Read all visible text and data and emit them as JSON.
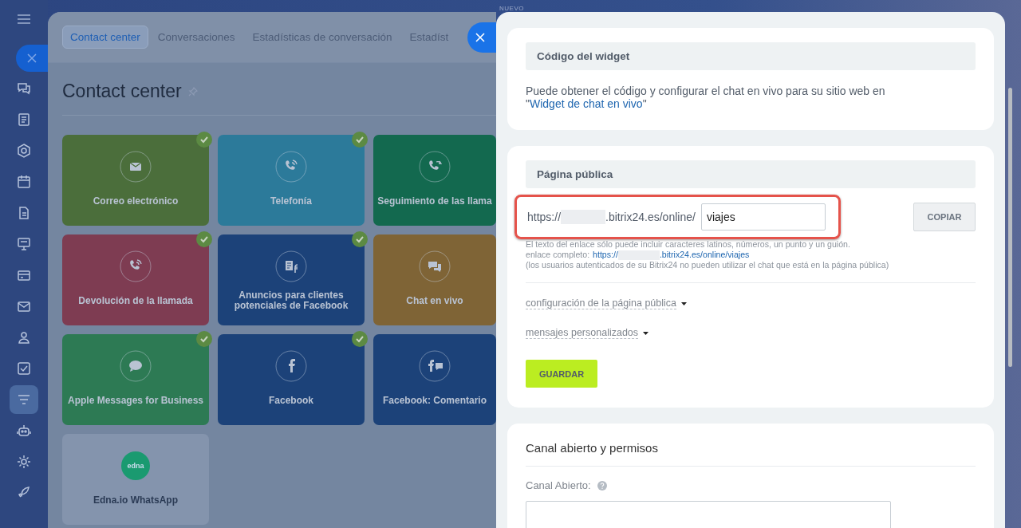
{
  "wallpaper_label": "NUEVO",
  "sidebar": {
    "items": [
      {
        "kind": "close",
        "selected": false
      },
      {
        "kind": "chat",
        "selected": false
      },
      {
        "kind": "document",
        "selected": false
      },
      {
        "kind": "hexagon",
        "selected": false
      },
      {
        "kind": "calendar",
        "selected": false
      },
      {
        "kind": "page",
        "selected": false
      },
      {
        "kind": "board",
        "selected": false
      },
      {
        "kind": "card",
        "selected": false
      },
      {
        "kind": "mail",
        "selected": false
      },
      {
        "kind": "people",
        "selected": false
      },
      {
        "kind": "checkbox",
        "selected": false
      },
      {
        "kind": "filter",
        "selected": true
      },
      {
        "kind": "robot",
        "selected": false
      },
      {
        "kind": "settings",
        "selected": false
      },
      {
        "kind": "rocket",
        "selected": false
      }
    ]
  },
  "page": {
    "tabs": [
      {
        "label": "Contact center",
        "selected": true
      },
      {
        "label": "Conversaciones",
        "selected": false
      },
      {
        "label": "Estadísticas de conversación",
        "selected": false
      },
      {
        "label": "Estadíst",
        "selected": false
      }
    ],
    "title": "Contact center",
    "tiles": [
      {
        "label": "Correo electrónico",
        "kind": "mail",
        "color": "#4b6e3b",
        "connected": true
      },
      {
        "label": "Telefonía",
        "kind": "phone",
        "color": "#2c7a9a",
        "connected": true
      },
      {
        "label": "Seguimiento de las llama",
        "kind": "phone-sync",
        "color": "#13694f",
        "connected": false
      },
      {
        "label": "Devolución de la llamada",
        "kind": "phone",
        "color": "#7e3c52",
        "connected": true
      },
      {
        "label": "Anuncios para clientes potenciales de Facebook",
        "kind": "ads",
        "color": "#1c4279",
        "connected": true
      },
      {
        "label": "Chat en vivo",
        "kind": "chat",
        "color": "#7f6436",
        "connected": false
      },
      {
        "label": "Apple Messages for Business",
        "kind": "message",
        "color": "#2d7a54",
        "connected": true
      },
      {
        "label": "Facebook",
        "kind": "facebook",
        "color": "#1c4279",
        "connected": true
      },
      {
        "label": "Facebook: Comentario",
        "kind": "facebook-chat",
        "color": "#1c4279",
        "connected": false
      },
      {
        "label": "Edna.io WhatsApp",
        "kind": "edna",
        "color": "#8494ad",
        "connected": false,
        "logo_text": "edna"
      }
    ]
  },
  "panel": {
    "widget_section": {
      "heading": "Código del widget",
      "text_before": "Puede obtener el código y configurar el chat en vivo para su sitio web en \"",
      "link": "Widget de chat en vivo",
      "text_after": "\""
    },
    "public_page": {
      "heading": "Página pública",
      "url_prefix": "https://",
      "url_suffix": ".bitrix24.es/online/",
      "slug": "viajes",
      "highlighted": true,
      "copy_button": "COPIAR",
      "hint": "El texto del enlace sólo puede incluir caracteres latinos, números, un punto y un guión.",
      "full_link_label": "enlace completo:",
      "full_link_prefix": "https://",
      "full_link_suffix": ".bitrix24.es/online/viajes",
      "note": "(los usuarios autenticados de su Bitrix24 no pueden utilizar el chat que está en la página pública)",
      "dropdowns": [
        {
          "label": "configuración de la página pública",
          "expanded": false
        },
        {
          "label": "mensajes personalizados",
          "expanded": false
        }
      ],
      "save_button": "GUARDAR"
    },
    "permissions": {
      "heading": "Canal abierto y permisos",
      "field_label": "Canal Abierto:"
    }
  }
}
